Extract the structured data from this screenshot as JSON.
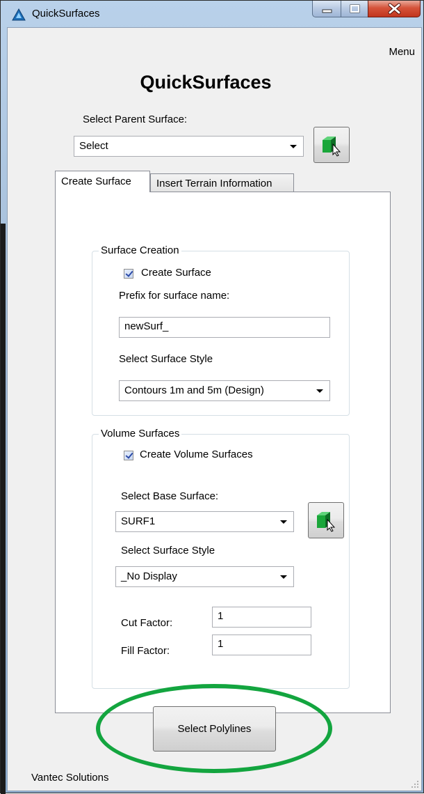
{
  "window": {
    "title": "QuickSurfaces"
  },
  "menu": {
    "label": "Menu"
  },
  "header": {
    "title": "QuickSurfaces"
  },
  "parent_surface": {
    "label": "Select Parent Surface:",
    "value": "Select"
  },
  "tabs": [
    {
      "label": "Create Surface",
      "active": true
    },
    {
      "label": "Insert Terrain Information",
      "active": false
    }
  ],
  "surface_creation": {
    "group_title": "Surface Creation",
    "create_checkbox": {
      "label": "Create Surface",
      "checked": true
    },
    "prefix_label": "Prefix for surface name:",
    "prefix_value": "newSurf_",
    "style_label": "Select Surface Style",
    "style_value": "Contours 1m and 5m (Design)"
  },
  "volume_surfaces": {
    "group_title": "Volume Surfaces",
    "create_checkbox": {
      "label": "Create Volume Surfaces",
      "checked": true
    },
    "base_label": "Select Base Surface:",
    "base_value": "SURF1",
    "style_label": "Select Surface Style",
    "style_value": "_No Display",
    "cut_label": "Cut Factor:",
    "cut_value": "1",
    "fill_label": "Fill Factor:",
    "fill_value": "1"
  },
  "actions": {
    "select_polylines": "Select Polylines"
  },
  "footer": {
    "text": "Vantec Solutions"
  },
  "colors": {
    "highlight_ellipse": "#13a53f",
    "cube_icon": "#1aa63a",
    "close_button": "#c94a33"
  },
  "icons": {
    "app": "autodesk-a-icon",
    "pick": "green-cube-cursor-icon"
  }
}
